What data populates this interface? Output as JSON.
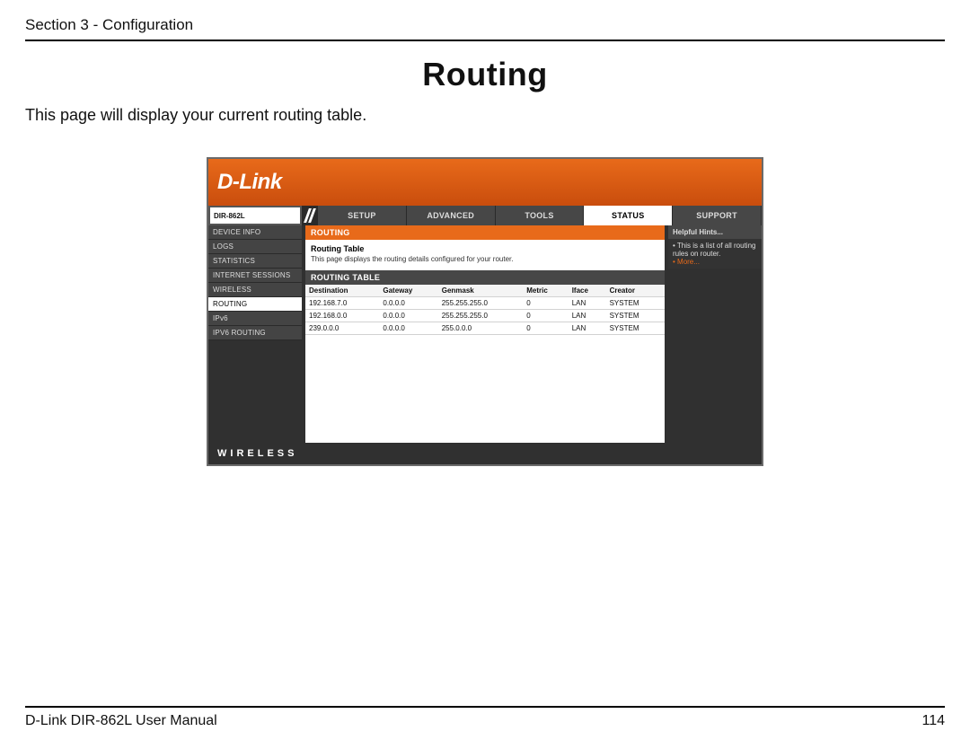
{
  "section_header": "Section 3 - Configuration",
  "page_title": "Routing",
  "page_desc": "This page will display your current routing table.",
  "router": {
    "brand": "D-Link",
    "model": "DIR-862L",
    "tabs": [
      "SETUP",
      "ADVANCED",
      "TOOLS",
      "STATUS",
      "SUPPORT"
    ],
    "active_tab": "STATUS",
    "sidebar": [
      "DEVICE INFO",
      "LOGS",
      "STATISTICS",
      "INTERNET SESSIONS",
      "WIRELESS",
      "ROUTING",
      "IPv6",
      "IPV6 ROUTING"
    ],
    "sidebar_selected": "ROUTING",
    "section1_heading": "ROUTING",
    "panel_title": "Routing Table",
    "panel_text": "This page displays the routing details configured for your router.",
    "section2_heading": "ROUTING TABLE",
    "table": {
      "headers": [
        "Destination",
        "Gateway",
        "Genmask",
        "Metric",
        "Iface",
        "Creator"
      ],
      "rows": [
        [
          "192.168.7.0",
          "0.0.0.0",
          "255.255.255.0",
          "0",
          "LAN",
          "SYSTEM"
        ],
        [
          "192.168.0.0",
          "0.0.0.0",
          "255.255.255.0",
          "0",
          "LAN",
          "SYSTEM"
        ],
        [
          "239.0.0.0",
          "0.0.0.0",
          "255.0.0.0",
          "0",
          "LAN",
          "SYSTEM"
        ]
      ]
    },
    "hints": {
      "heading": "Helpful Hints...",
      "line1": "This is a list of all routing rules on router.",
      "more": "More..."
    },
    "bottom_brand": "WIRELESS"
  },
  "footer_left": "D-Link DIR-862L User Manual",
  "footer_right": "114"
}
